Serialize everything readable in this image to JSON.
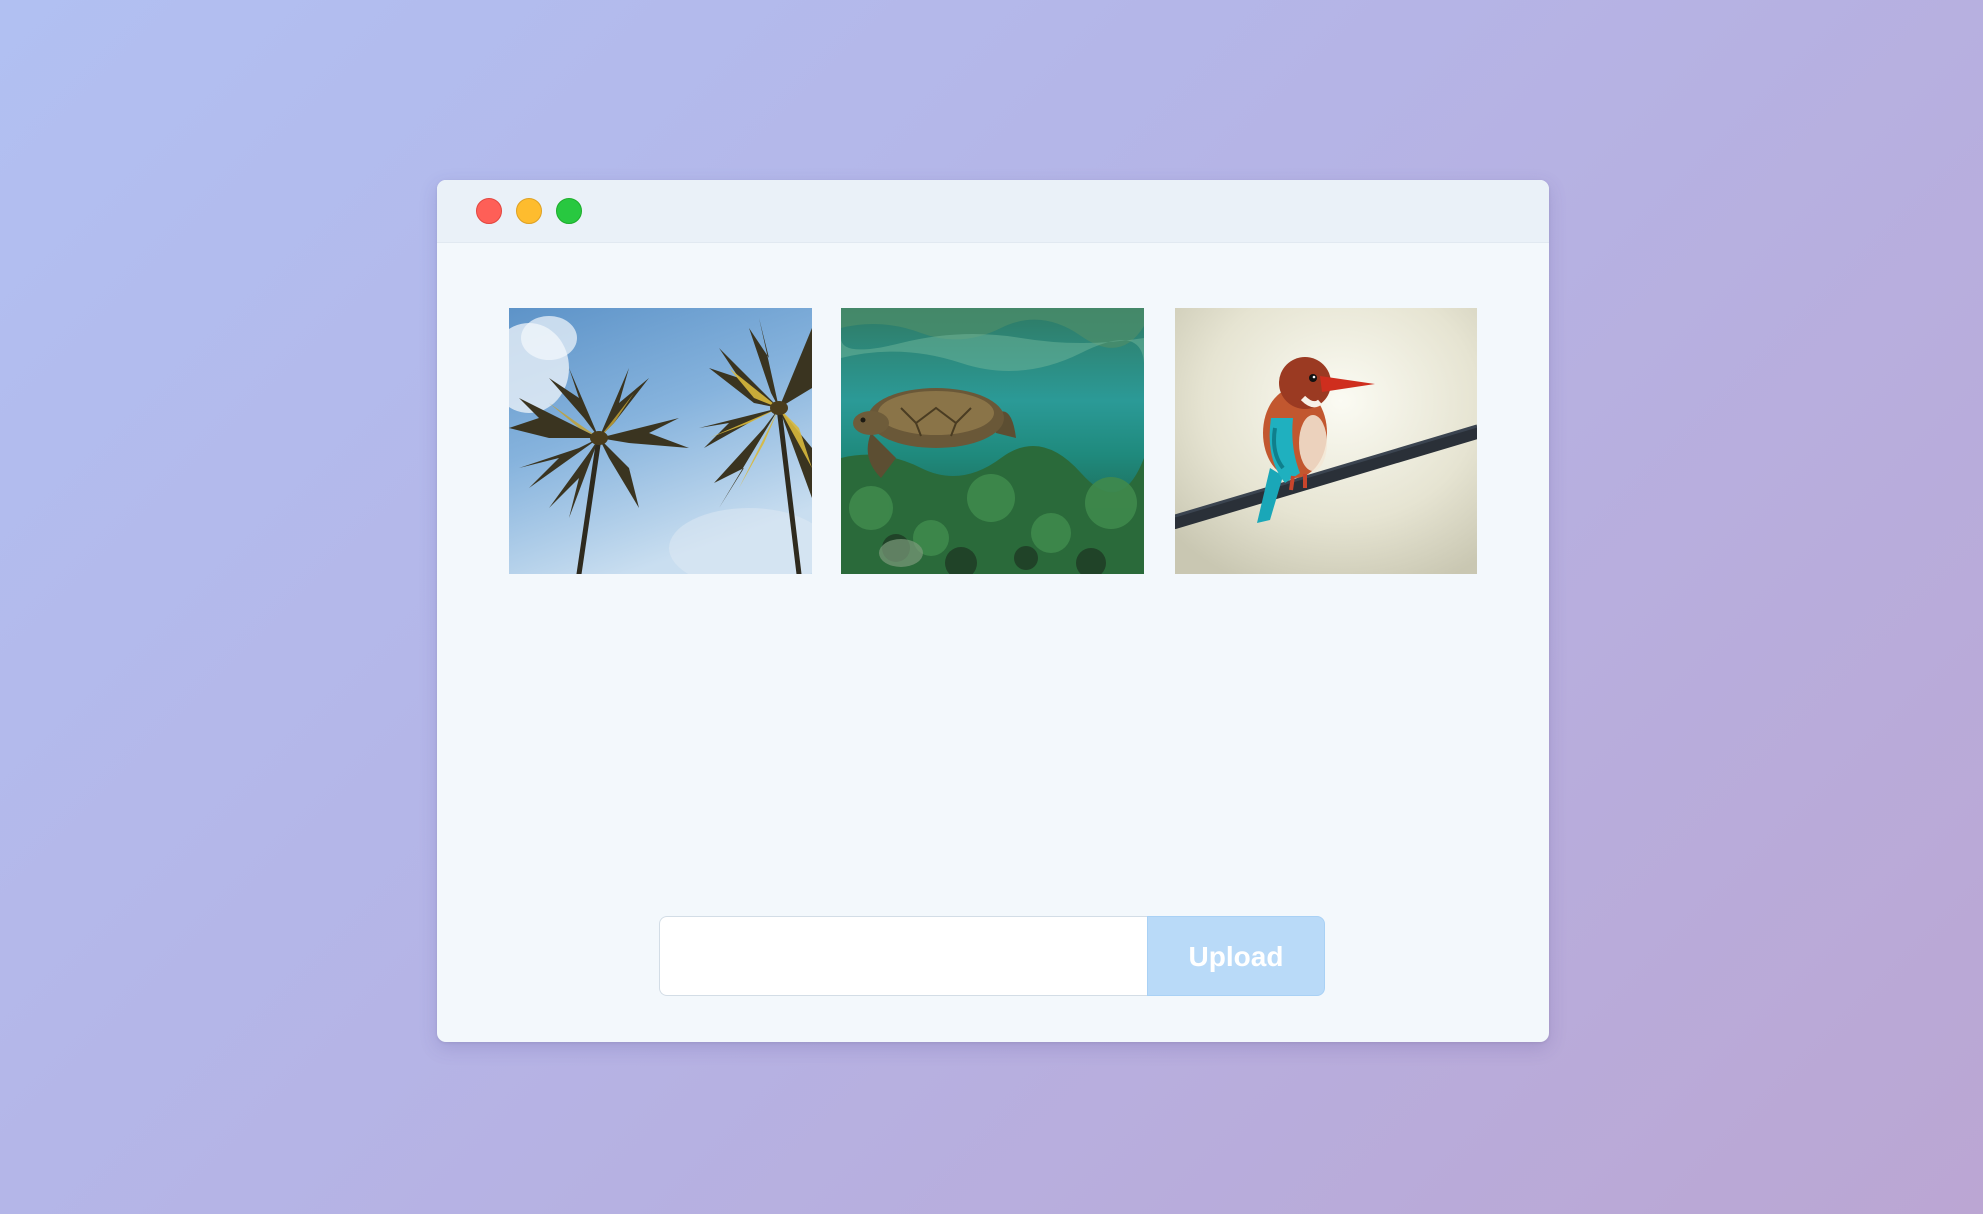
{
  "window": {
    "controls": [
      {
        "name": "close",
        "color": "#fe5f57"
      },
      {
        "name": "minimize",
        "color": "#febc2e"
      },
      {
        "name": "zoom",
        "color": "#28c840"
      }
    ]
  },
  "gallery": {
    "images": [
      {
        "subject": "palm-trees",
        "icon": "palm-trees-photo"
      },
      {
        "subject": "sea-turtle",
        "icon": "sea-turtle-photo"
      },
      {
        "subject": "kingfisher-bird",
        "icon": "kingfisher-photo"
      }
    ]
  },
  "upload": {
    "input_value": "",
    "input_placeholder": "",
    "button_label": "Upload",
    "button_color": "#b9daf8"
  }
}
